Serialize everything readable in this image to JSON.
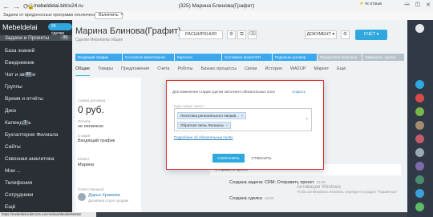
{
  "browser": {
    "url": "mebeldelai.bitrix24.ru",
    "tab_title": "(325) Марина Блинова(Графит)",
    "notification": "Задачи от вредоносных программ отключена",
    "enable_label": "Включить",
    "extension_label": "тк отзыв",
    "status_url": "https://mebeldelai.bitrix24.ru/crm/deal/details/55452/"
  },
  "sidebar": {
    "brand": "Mebeldelai",
    "pill": "24 сделки",
    "items": [
      {
        "label": "Задачи и Проекты",
        "count": "99"
      },
      {
        "label": "База знаний",
        "count": ""
      },
      {
        "label": "Ежедневник",
        "count": ""
      },
      {
        "label": "Чат и звонки",
        "count": "99"
      },
      {
        "label": "Группы",
        "count": ""
      },
      {
        "label": "Время и отчёты",
        "count": ""
      },
      {
        "label": "Диск",
        "count": ""
      },
      {
        "label": "Календарь",
        "count": "1"
      },
      {
        "label": "Бухгалтерия Филиала",
        "count": ""
      },
      {
        "label": "Сайты",
        "count": ""
      },
      {
        "label": "Сквозная аналитика",
        "count": ""
      },
      {
        "label": "Мои ...",
        "count": ""
      },
      {
        "label": "Телефония",
        "count": ""
      },
      {
        "label": "Сотрудники",
        "count": ""
      },
      {
        "label": "Ещё",
        "count": ""
      }
    ]
  },
  "deal": {
    "title": "Марина Блинова(Графит)",
    "breadcrumb": "Сделки Mebeldelai общее",
    "extensions_label": "РАСШИРЕНИЯ",
    "document_label": "ДОКУМЕНТ",
    "account_label": "СЧЁТ",
    "stages": [
      {
        "label": "Входящий трафик",
        "color": "#39a8ef"
      },
      {
        "label": "Состоялся визит/звонок",
        "color": "#39a8ef"
      },
      {
        "label": "Карточка",
        "color": "#39a8ef"
      },
      {
        "label": "Составлен проект/КП",
        "color": "#39a8ef"
      },
      {
        "label": "Подписан договор",
        "color": "#39a8ef"
      },
      {
        "label": "Предоплата получена",
        "color": "#b6c2c9"
      },
      {
        "label": "Завершить сделку",
        "color": "#b6c2c9"
      }
    ],
    "tabs": [
      "Общие",
      "Товары",
      "Предложения",
      "Счета",
      "Роботы",
      "Бизнес-процессы",
      "Связи",
      "История",
      "WAZUP",
      "Маркет",
      "Ещё"
    ]
  },
  "info": {
    "amount_label": "Сумма договора",
    "amount": "0 руб.",
    "status_label": "Оплата",
    "status": "не оплачено",
    "stage_label": "Стадия",
    "stage": "Входящий трафик",
    "client_label": "Клиент",
    "client_name": "Марина",
    "responsible_label": "Ответственный",
    "responsible_name": "Дарья Храмова",
    "responsible_role": "Дизайнер отдел продаж"
  },
  "activity": {
    "rows": [
      {
        "text": "Создана задача: CRM: Отправить проект",
        "time": "16:09"
      },
      {
        "text": "Создана сделка",
        "time": "16:08"
      }
    ],
    "note": "Отправить проект"
  },
  "modal": {
    "heading": "Для изменения стадии сделки заполните обязательные поля",
    "open_label": "открыть",
    "field_label": "Куда пойдет заказ?",
    "chips": [
      "Логистика регионального направ...",
      "Обратная связь Филиалы"
    ],
    "link": "Подробнее об обязательных полях",
    "save_label": "СОХРАНИТЬ",
    "cancel_label": "ОТМЕНИТЬ"
  },
  "watermark": {
    "title": "Активация Windows",
    "sub": "Чтобы активировать Windows, перейдите в раздел \"Параметры\""
  }
}
